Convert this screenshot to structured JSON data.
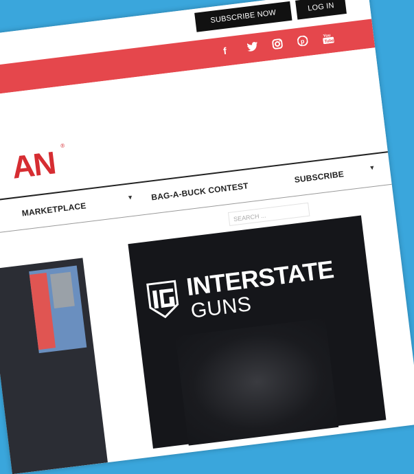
{
  "header": {
    "subscribe_now": "SUBSCRIBE NOW",
    "log_in": "LOG IN"
  },
  "social": [
    {
      "name": "facebook-icon",
      "glyph": "f"
    },
    {
      "name": "twitter-icon",
      "glyph": "🐦"
    },
    {
      "name": "instagram-icon",
      "glyph": "◎"
    },
    {
      "name": "pinterest-icon",
      "glyph": "℗"
    },
    {
      "name": "youtube-icon",
      "glyph": "▶"
    }
  ],
  "logo": {
    "text": "AN",
    "reg": "®"
  },
  "nav": {
    "marketplace": "MARKETPLACE",
    "bag_a_buck": "BAG-A-BUCK CONTEST",
    "subscribe": "SUBSCRIBE",
    "caret": "▼"
  },
  "search": {
    "placeholder": "SEARCH ..."
  },
  "ad": {
    "title": "INTERSTATE",
    "subtitle": "GUNS"
  },
  "colors": {
    "background": "#3aa6dc",
    "redbar": "#e5474c",
    "logo": "#d62d32",
    "button": "#111111"
  }
}
